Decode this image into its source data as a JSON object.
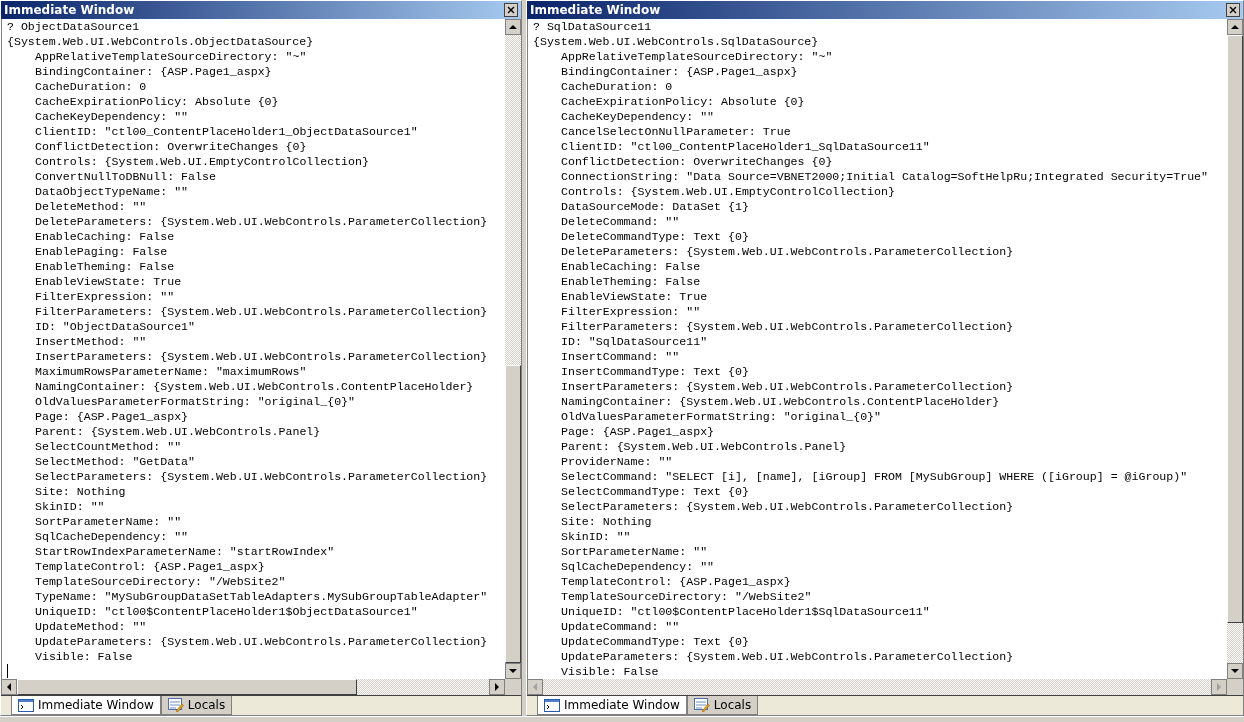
{
  "panes": [
    {
      "title": "Immediate Window",
      "query": "? ObjectDataSource1",
      "result": "{System.Web.UI.WebControls.ObjectDataSource}",
      "caret_line": true,
      "horizontal_scrollbar": {
        "disabled": false
      },
      "properties": [
        "AppRelativeTemplateSourceDirectory: \"~\"",
        "BindingContainer: {ASP.Page1_aspx}",
        "CacheDuration: 0",
        "CacheExpirationPolicy: Absolute {0}",
        "CacheKeyDependency: \"\"",
        "ClientID: \"ctl00_ContentPlaceHolder1_ObjectDataSource1\"",
        "ConflictDetection: OverwriteChanges {0}",
        "Controls: {System.Web.UI.EmptyControlCollection}",
        "ConvertNullToDBNull: False",
        "DataObjectTypeName: \"\"",
        "DeleteMethod: \"\"",
        "DeleteParameters: {System.Web.UI.WebControls.ParameterCollection}",
        "EnableCaching: False",
        "EnablePaging: False",
        "EnableTheming: False",
        "EnableViewState: True",
        "FilterExpression: \"\"",
        "FilterParameters: {System.Web.UI.WebControls.ParameterCollection}",
        "ID: \"ObjectDataSource1\"",
        "InsertMethod: \"\"",
        "InsertParameters: {System.Web.UI.WebControls.ParameterCollection}",
        "MaximumRowsParameterName: \"maximumRows\"",
        "NamingContainer: {System.Web.UI.WebControls.ContentPlaceHolder}",
        "OldValuesParameterFormatString: \"original_{0}\"",
        "Page: {ASP.Page1_aspx}",
        "Parent: {System.Web.UI.WebControls.Panel}",
        "SelectCountMethod: \"\"",
        "SelectMethod: \"GetData\"",
        "SelectParameters: {System.Web.UI.WebControls.ParameterCollection}",
        "Site: Nothing",
        "SkinID: \"\"",
        "SortParameterName: \"\"",
        "SqlCacheDependency: \"\"",
        "StartRowIndexParameterName: \"startRowIndex\"",
        "TemplateControl: {ASP.Page1_aspx}",
        "TemplateSourceDirectory: \"/WebSite2\"",
        "TypeName: \"MySubGroupDataSetTableAdapters.MySubGroupTableAdapter\"",
        "UniqueID: \"ctl00$ContentPlaceHolder1$ObjectDataSource1\"",
        "UpdateMethod: \"\"",
        "UpdateParameters: {System.Web.UI.WebControls.ParameterCollection}",
        "Visible: False"
      ],
      "tabs": [
        {
          "label": "Immediate Window",
          "kind": "immediate",
          "selected": true
        },
        {
          "label": "Locals",
          "kind": "locals",
          "selected": false
        }
      ]
    },
    {
      "title": "Immediate Window",
      "query": "? SqlDataSource11",
      "result": "{System.Web.UI.WebControls.SqlDataSource}",
      "caret_line": false,
      "horizontal_scrollbar": {
        "disabled": true
      },
      "properties": [
        "AppRelativeTemplateSourceDirectory: \"~\"",
        "BindingContainer: {ASP.Page1_aspx}",
        "CacheDuration: 0",
        "CacheExpirationPolicy: Absolute {0}",
        "CacheKeyDependency: \"\"",
        "CancelSelectOnNullParameter: True",
        "ClientID: \"ctl00_ContentPlaceHolder1_SqlDataSource11\"",
        "ConflictDetection: OverwriteChanges {0}",
        "ConnectionString: \"Data Source=VBNET2000;Initial Catalog=SoftHelpRu;Integrated Security=True\"",
        "Controls: {System.Web.UI.EmptyControlCollection}",
        "DataSourceMode: DataSet {1}",
        "DeleteCommand: \"\"",
        "DeleteCommandType: Text {0}",
        "DeleteParameters: {System.Web.UI.WebControls.ParameterCollection}",
        "EnableCaching: False",
        "EnableTheming: False",
        "EnableViewState: True",
        "FilterExpression: \"\"",
        "FilterParameters: {System.Web.UI.WebControls.ParameterCollection}",
        "ID: \"SqlDataSource11\"",
        "InsertCommand: \"\"",
        "InsertCommandType: Text {0}",
        "InsertParameters: {System.Web.UI.WebControls.ParameterCollection}",
        "NamingContainer: {System.Web.UI.WebControls.ContentPlaceHolder}",
        "OldValuesParameterFormatString: \"original_{0}\"",
        "Page: {ASP.Page1_aspx}",
        "Parent: {System.Web.UI.WebControls.Panel}",
        "ProviderName: \"\"",
        "SelectCommand: \"SELECT [i], [name], [iGroup] FROM [MySubGroup] WHERE ([iGroup] = @iGroup)\"",
        "SelectCommandType: Text {0}",
        "SelectParameters: {System.Web.UI.WebControls.ParameterCollection}",
        "Site: Nothing",
        "SkinID: \"\"",
        "SortParameterName: \"\"",
        "SqlCacheDependency: \"\"",
        "TemplateControl: {ASP.Page1_aspx}",
        "TemplateSourceDirectory: \"/WebSite2\"",
        "UniqueID: \"ctl00$ContentPlaceHolder1$SqlDataSource11\"",
        "UpdateCommand: \"\"",
        "UpdateCommandType: Text {0}",
        "UpdateParameters: {System.Web.UI.WebControls.ParameterCollection}",
        "Visible: False"
      ],
      "tabs": [
        {
          "label": "Immediate Window",
          "kind": "immediate",
          "selected": true
        },
        {
          "label": "Locals",
          "kind": "locals",
          "selected": false
        }
      ]
    }
  ]
}
